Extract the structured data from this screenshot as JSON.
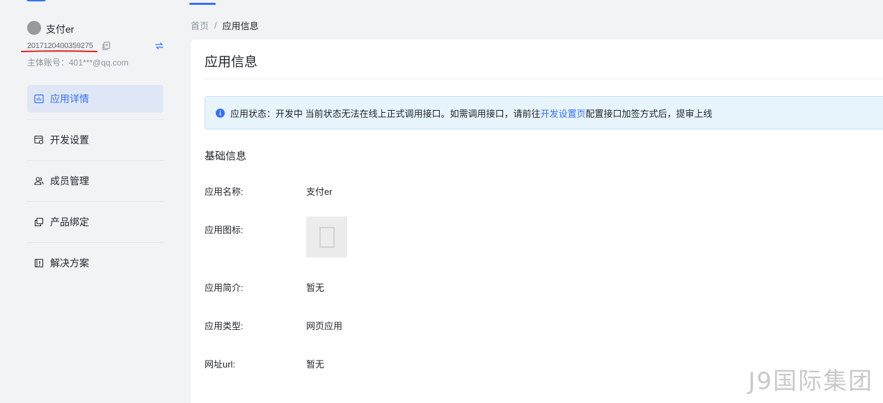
{
  "sidebar": {
    "app_name": "支付er",
    "app_id": "2017120400359275",
    "owner_account": "主体账号：401***@qq.com",
    "nav": [
      {
        "label": "应用详情",
        "icon": "chart-icon",
        "active": true
      },
      {
        "label": "开发设置",
        "icon": "dev-settings-icon",
        "active": false
      },
      {
        "label": "成员管理",
        "icon": "members-icon",
        "active": false
      },
      {
        "label": "产品绑定",
        "icon": "product-bind-icon",
        "active": false
      },
      {
        "label": "解决方案",
        "icon": "solution-icon",
        "active": false
      }
    ]
  },
  "breadcrumb": {
    "home": "首页",
    "separator": "/",
    "current": "应用信息"
  },
  "main": {
    "title": "应用信息",
    "notice": {
      "prefix": "应用状态：开发中 当前状态无法在线上正式调用接口。如需调用接口，请前往",
      "link": "开发设置页",
      "suffix": "配置接口加签方式后，提审上线"
    },
    "section_title": "基础信息",
    "fields": {
      "name_label": "应用名称:",
      "name_value": "支付er",
      "icon_label": "应用图标:",
      "intro_label": "应用简介:",
      "intro_value": "暂无",
      "type_label": "应用类型:",
      "type_value": "网页应用",
      "url_label": "网址url:",
      "url_value": "暂无"
    }
  },
  "watermark": "J9国际集团",
  "colors": {
    "accent": "#3370ff",
    "active_bg": "#dfe7f6",
    "notice_bg": "#e8f4fc",
    "annotation_red": "#e02020"
  }
}
